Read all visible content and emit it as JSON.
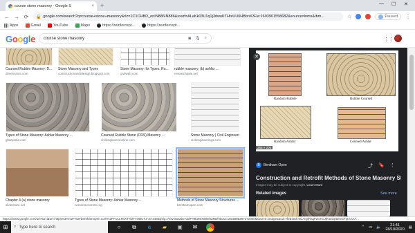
{
  "browser": {
    "tab_title": "course stone masonry - Google S",
    "tab_close": "×",
    "new_tab": "+",
    "win_min": "—",
    "win_max": "☐",
    "win_close": "✕",
    "url": "google.com/search?q=course+stone+masonry&rlz=1C1CHBD_enIN886IN886&sxsrf=ALeKk03U1q1j3dwoKTHtxUU0HBbnX3Fw:1603901558682&source=lnms&tbm...",
    "profile_status": "Paused"
  },
  "bookmarks": [
    {
      "label": "Apps",
      "color": "#5f6368"
    },
    {
      "label": "Gmail",
      "color": "#ea4335"
    },
    {
      "label": "YouTube",
      "color": "#ff0000"
    },
    {
      "label": "Maps",
      "color": "#34a853"
    },
    {
      "label": "https://reinforcept...",
      "color": "#202124"
    },
    {
      "label": "https://reinforcept...",
      "color": "#202124"
    }
  ],
  "google": {
    "logo_letters": [
      "G",
      "o",
      "o",
      "g",
      "l",
      "e"
    ],
    "search_value": "course stone masonry"
  },
  "results": [
    {
      "caption": "Coursed Rubble Masonry: D...",
      "source": "dimensions.com",
      "style": "tan"
    },
    {
      "caption": "Stone Masonry and Types",
      "source": "constructionandrdesign.blogspot.com",
      "style": "cream"
    },
    {
      "caption": "Stone Masonry: Its Types, Ru...",
      "source": "civilweb.com",
      "style": "sketch"
    },
    {
      "caption": "rubble masonry; (b) ashlar ...",
      "source": "researchgate.net",
      "style": "light"
    },
    {
      "caption": "Types of Stone Masonry: Ashlar Masonry ...",
      "source": "gharpedia.com",
      "style": "grey"
    },
    {
      "caption": "Coursed Rubble Stone (CRS) Masonry ...",
      "source": "civilengineersonline.com",
      "style": "grey"
    },
    {
      "caption": "Stone Masonry | Civil Engineering",
      "source": "civilengineerings.com",
      "style": "light"
    },
    {
      "caption": "Chapter 4 (a) stone masonry",
      "source": "slideshare.net",
      "style": "arch"
    },
    {
      "caption": "Types of Stone Masonry: Ashlar Masonry ...",
      "source": "cementconcrete.org",
      "style": "sketch"
    },
    {
      "caption": "Methods of Stone Masonry Structures ...",
      "source": "benthamopen.com",
      "style": "brick"
    }
  ],
  "preview": {
    "image_labels": [
      "Random Rubble",
      "Rubble Coursed",
      "Random Ashlar",
      "Coursed Ashlar"
    ],
    "dimensions": "256 × 205",
    "source_name": "Bentham Open",
    "title": "Construction and Retrofit Methods of Stone Masonry Stru...",
    "note": "Images may be subject to copyright.",
    "learn_more": "Learn More",
    "related_heading": "Related images",
    "see_more": "See more"
  },
  "status_url": "https://www.google.com/url?sa=i&url=https%3A%2F%2Fbenthamopen.com%2FFULLTEXT%2FTOBCTJ-10-346&psig=AOvVaw2bxYZdPYBu8670WebZRDh&ust=1603988397372000&source=images&cd=vfe&ved=0CAIQjRxqFwoTCJjFaaGp5ewCFQAAAA...",
  "taskbar": {
    "search_placeholder": "Type here to search",
    "time": "21:41",
    "date": "28/10/2020"
  }
}
